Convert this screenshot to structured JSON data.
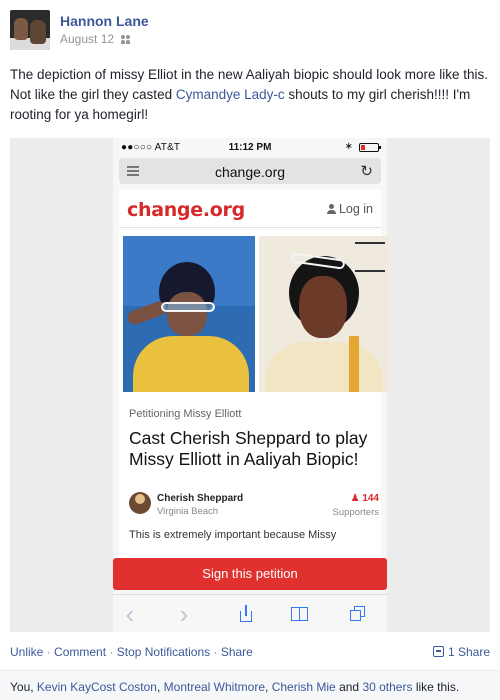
{
  "post": {
    "author": "Hannon Lane",
    "date": "August 12",
    "audience_icon": "friends-icon",
    "text_part1": "The depiction of missy Elliot in the new Aaliyah biopic should look more like this. Not like the girl they casted ",
    "mention": "Cymandye Lady-c",
    "text_part2": " shouts to my girl cherish!!!! I'm rooting for ya homegirl!"
  },
  "phone": {
    "carrier": "●●○○○ AT&T",
    "time": "11:12 PM",
    "bluetooth": "∗",
    "url": "change.org",
    "reload_icon": "↻"
  },
  "site": {
    "logo": "change.org",
    "login": "Log in",
    "kicker": "Petitioning Missy Elliott",
    "title": "Cast Cherish Sheppard to play Missy Elliott in Aaliyah Biopic!",
    "creator_name": "Cherish Sheppard",
    "creator_location": "Virginia Beach",
    "supporters_count": "144",
    "supporters_label": "Supporters",
    "excerpt": "This is extremely important because Missy",
    "sign_button": "Sign this petition"
  },
  "toolbar": {
    "back": "‹",
    "forward": "›"
  },
  "actions": {
    "unlike": "Unlike",
    "comment": "Comment",
    "stop_notifications": "Stop Notifications",
    "share": "Share",
    "sep": "·",
    "share_count": "1 Share"
  },
  "likes": {
    "prefix": "You, ",
    "liker1": "Kevin KayCost Coston",
    "sep1": ", ",
    "liker2": "Montreal Whitmore",
    "sep2": ", ",
    "liker3": "Cherish Mie",
    "and": " and ",
    "others": "30 others",
    "suffix": " like this."
  },
  "colors": {
    "facebook_blue": "#3b5998",
    "change_red": "#d62a2a",
    "ios_blue": "#3478f6"
  }
}
